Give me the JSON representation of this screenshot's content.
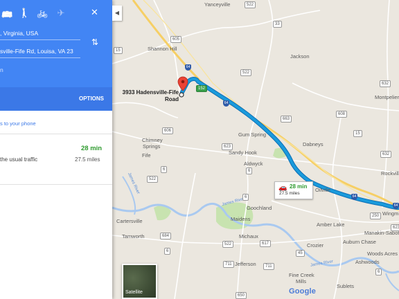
{
  "panel": {
    "modes": [
      {
        "name": "transit-mode-button",
        "icon": "bus-icon",
        "glyph": "🚌"
      },
      {
        "name": "walking-mode-button",
        "icon": "walking-icon",
        "glyph": "🚶"
      },
      {
        "name": "cycling-mode-button",
        "icon": "bicycle-icon",
        "glyph": "🚲"
      },
      {
        "name": "flight-mode-button",
        "icon": "airplane-icon",
        "glyph": "✈"
      }
    ],
    "close_glyph": "✕",
    "origin_value": ", Virginia, USA",
    "destination_value": "sville-Fife Rd, Louisa, VA 23",
    "swap_glyph": "⇅",
    "add_destination_partial": "n",
    "options_label": "OPTIONS",
    "send_to_phone_partial": "s to your phone",
    "route": {
      "duration": "28 min",
      "traffic_note_partial": "the usual traffic",
      "distance": "27.5 miles"
    },
    "collapse_glyph": "◀"
  },
  "map": {
    "destination_label_line1": "3933 Hadensville-Fife",
    "destination_label_line2": "Road",
    "route_card": {
      "duration": "28 min",
      "distance": "27.5 miles",
      "icon": "car-icon"
    },
    "satellite_label": "Satellite",
    "google_logo": "Google",
    "places": [
      {
        "name": "Yanceyville"
      },
      {
        "name": "Shannon Hill"
      },
      {
        "name": "Jackson"
      },
      {
        "name": "Montpelier"
      },
      {
        "name": "Gum Spring"
      },
      {
        "name": "Dabneys"
      },
      {
        "name": "Chimney"
      },
      {
        "name": "Springs"
      },
      {
        "name": "Sandy Hook"
      },
      {
        "name": "Fife"
      },
      {
        "name": "Aldwyck"
      },
      {
        "name": "Rockvill"
      },
      {
        "name": "Oilville"
      },
      {
        "name": "Wingm"
      },
      {
        "name": "Goochland"
      },
      {
        "name": "Maidens"
      },
      {
        "name": "Cartersville"
      },
      {
        "name": "Tamworth"
      },
      {
        "name": "Amber Lake"
      },
      {
        "name": "Manakin-Sabot"
      },
      {
        "name": "Auburn Chase"
      },
      {
        "name": "Michaux"
      },
      {
        "name": "Crozier"
      },
      {
        "name": "Woods Acres"
      },
      {
        "name": "Ashwoods"
      },
      {
        "name": "Jefferson"
      },
      {
        "name": "Fine Creek"
      },
      {
        "name": "Mills"
      },
      {
        "name": "Sublets"
      },
      {
        "name": "James River"
      },
      {
        "name": "James River"
      },
      {
        "name": "James River"
      }
    ],
    "shields": [
      "522",
      "33",
      "605",
      "15",
      "522",
      "632",
      "64",
      "152",
      "64",
      "663",
      "608",
      "15",
      "623",
      "632",
      "606",
      "6",
      "6",
      "522",
      "250",
      "623",
      "6",
      "684",
      "6",
      "522",
      "617",
      "45",
      "711",
      "711",
      "6",
      "650",
      "64",
      "64",
      "250"
    ],
    "colors": {
      "route": "#1a9bdc",
      "route_outline": "#0e6fb5",
      "interstate": "#f6cf65",
      "water": "#a9c9f0",
      "park": "#c8e3b0",
      "duration": "#2e9a2e",
      "panel": "#4285f4",
      "pin": "#ea4335"
    }
  }
}
